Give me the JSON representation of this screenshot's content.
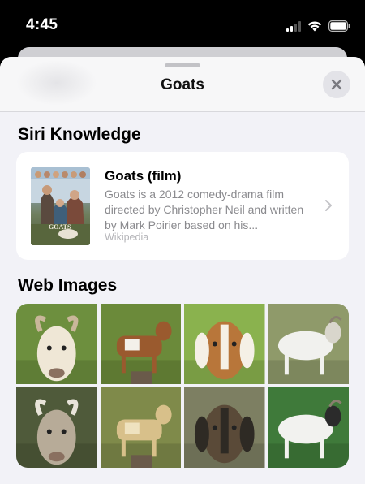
{
  "status_bar": {
    "time": "4:45",
    "signal_icon": "cellular-signal-icon",
    "wifi_icon": "wifi-icon",
    "battery_icon": "battery-icon"
  },
  "sheet": {
    "title": "Goats",
    "close_icon": "close-icon"
  },
  "siri_knowledge": {
    "heading": "Siri Knowledge",
    "title": "Goats (film)",
    "description": "Goats is a 2012 comedy-drama film directed by Christopher Neil and written by Mark Poirier based on his...",
    "source": "Wikipedia",
    "poster_title": "GOATS",
    "chevron_icon": "chevron-right-icon"
  },
  "web_images": {
    "heading": "Web Images",
    "images": [
      {
        "name": "goat-image-1",
        "bg": "#6d8f3e",
        "body": "#efe7d6",
        "accent": "#c9b79a"
      },
      {
        "name": "goat-image-2",
        "bg": "#6b8a3a",
        "body": "#9a5a2e",
        "accent": "#f3f0ea"
      },
      {
        "name": "goat-image-3",
        "bg": "#8ab24e",
        "body": "#b8763a",
        "accent": "#f5f0e6"
      },
      {
        "name": "goat-image-4",
        "bg": "#8f9a6a",
        "body": "#f1f1ee",
        "accent": "#d9d6cc"
      },
      {
        "name": "goat-image-5",
        "bg": "#4f5a3a",
        "body": "#b7ab98",
        "accent": "#e9e4da"
      },
      {
        "name": "goat-image-6",
        "bg": "#7f8a4a",
        "body": "#d8c08a",
        "accent": "#efe2bf"
      },
      {
        "name": "goat-image-7",
        "bg": "#7d7f62",
        "body": "#5a4a38",
        "accent": "#2e2a24"
      },
      {
        "name": "goat-image-8",
        "bg": "#3f7a3a",
        "body": "#f2f2ef",
        "accent": "#2b2b2b"
      }
    ]
  }
}
